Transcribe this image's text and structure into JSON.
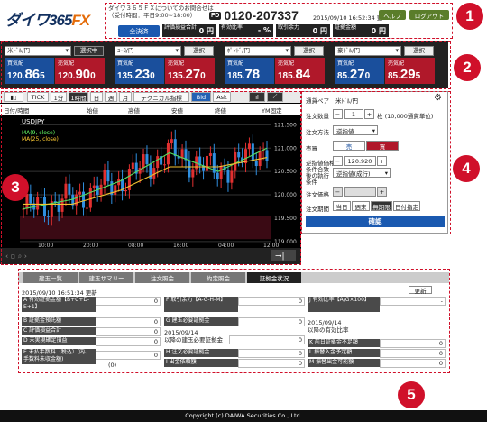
{
  "header": {
    "logo_main": "ダイワ365",
    "logo_fx": "FX",
    "notice_line1": "ダイワ３６５ＦＸについてのお問合せは",
    "notice_line2": "（受付時間：平日9:00~18:00）",
    "phone": "0120-207337",
    "freedial": "FD",
    "clock": "2015/09/10 16:52:34 更",
    "help": "ヘルプ",
    "logout": "ログアウト",
    "settle": "全決済",
    "stat1_label": "評価損益合計",
    "stat1_value": "0 円",
    "stat2_label": "有効比率",
    "stat2_value": "- %",
    "stat3_label": "取引余力",
    "stat3_value": "0 円",
    "stat4_label": "証拠金額",
    "stat4_value": "0 円"
  },
  "rates": [
    {
      "pair": "米ﾄﾞﾙ/円",
      "btn": "選択中",
      "bid_label": "買気配",
      "ask_label": "売気配",
      "bid_pre": "120.",
      "bid_big": "86",
      "bid_small": "5",
      "ask_pre": "120.",
      "ask_big": "90",
      "ask_small": "0"
    },
    {
      "pair": "ﾕｰﾛ/円",
      "btn": "選択",
      "bid_label": "買気配",
      "ask_label": "売気配",
      "bid_pre": "135.",
      "bid_big": "23",
      "bid_small": "0",
      "ask_pre": "135.",
      "ask_big": "27",
      "ask_small": "0"
    },
    {
      "pair": "ﾎﾟﾝﾄﾞ/円",
      "btn": "選択",
      "bid_label": "買気配",
      "ask_label": "売気配",
      "bid_pre": "185.",
      "bid_big": "78",
      "bid_small": "",
      "ask_pre": "185.",
      "ask_big": "84",
      "ask_small": ""
    },
    {
      "pair": "豪ﾄﾞﾙ/円",
      "btn": "選択",
      "bid_label": "買気配",
      "ask_label": "売気配",
      "bid_pre": "85.",
      "bid_big": "27",
      "bid_small": "0",
      "ask_pre": "85.",
      "ask_big": "29",
      "ask_small": "5"
    }
  ],
  "chart": {
    "toolbar": [
      "TICK",
      "1分",
      "1時間",
      "日",
      "週",
      "月",
      "テクニカル指標",
      "Bid",
      "Ask"
    ],
    "header_cols": [
      "日付/時間",
      "始値",
      "高値",
      "安値",
      "終値",
      "YM固定"
    ],
    "pair": "USDJPY",
    "legend1": "MA(9, close)",
    "legend2": "MA(25, close)",
    "y_ticks": [
      "121.500",
      "121.000",
      "120.500",
      "120.000",
      "119.500",
      "119.000"
    ],
    "x_ticks": [
      "10:00",
      "20:00",
      "08:00",
      "16:00",
      "04:00",
      "12:00"
    ]
  },
  "chart_data": {
    "type": "line",
    "title": "USDJPY",
    "x": [
      "10:00",
      "20:00",
      "08:00",
      "16:00",
      "04:00",
      "12:00"
    ],
    "series": [
      {
        "name": "MA(9, close)",
        "values": [
          119.7,
          119.9,
          120.3,
          120.9,
          120.5,
          121.0
        ]
      },
      {
        "name": "MA(25, close)",
        "values": [
          119.8,
          119.8,
          120.1,
          120.6,
          120.6,
          120.8
        ]
      }
    ],
    "ylim": [
      118.9,
      121.7
    ]
  },
  "order": {
    "pair_label": "通貨ペア",
    "pair_value": "米ﾄﾞﾙ/円",
    "qty_label": "注文数量",
    "qty_value": "1",
    "qty_unit": "枚 (10,000通貨単位)",
    "method_label": "注文方法",
    "method_value": "逆指値",
    "side_label": "売買",
    "sell": "売",
    "buy": "買",
    "price_label": "逆指値価格",
    "price_value": "120.920",
    "cond_label": "条件合致後の執行条件",
    "cond_value": "逆指値(成行)",
    "cond2_label": "注文価格",
    "exp_label": "注文期間",
    "exp_opts": [
      "当日",
      "週末",
      "無期限",
      "日付指定"
    ],
    "confirm": "確認"
  },
  "bottom": {
    "tabs": [
      "建玉一覧",
      "建玉サマリー",
      "注文照会",
      "約定照会",
      "証拠金状況"
    ],
    "updated": "2015/09/10 16:51:34 更新",
    "refresh": "更新",
    "cells": [
      {
        "label": "A 有効証拠金額【B+C+D-E+1】",
        "value": "0"
      },
      {
        "label": "F 取引余力【A-G-H-M】",
        "value": "0"
      },
      {
        "label": "J 有効比率【A/G×100】",
        "value": "-"
      },
      {
        "label": "B 証拠金預託額",
        "value": "0"
      },
      {
        "label": "G 建玉必要証拠金",
        "value": "0"
      },
      {
        "label": "C 評価損益合計",
        "value": "0"
      },
      {
        "label": "D 未実現確定損益",
        "value": "0"
      },
      {
        "label": "H 注文必要証拠金",
        "value": "0"
      },
      {
        "label": "K 前日証拠金不足額",
        "value": "0"
      },
      {
        "label": "E 未払手数料（税込）(内、手数料未収金額)",
        "value": "0"
      },
      {
        "label": "I 出金依頼額",
        "value": "0"
      },
      {
        "label": "L 振替入金予定額",
        "value": "0"
      },
      {
        "label": "M 振替出金可能額",
        "value": "0"
      }
    ],
    "date1": "2015/09/14",
    "date1_label": "以降の有効比率",
    "date2": "2015/09/14",
    "date2_label": "以降の建玉必要証拠金",
    "date2_value": "0",
    "paren": "(0)"
  },
  "footer": "Copyright (c) DAIWA Securities Co., Ltd.",
  "badges": [
    "1",
    "2",
    "3",
    "4",
    "5"
  ]
}
